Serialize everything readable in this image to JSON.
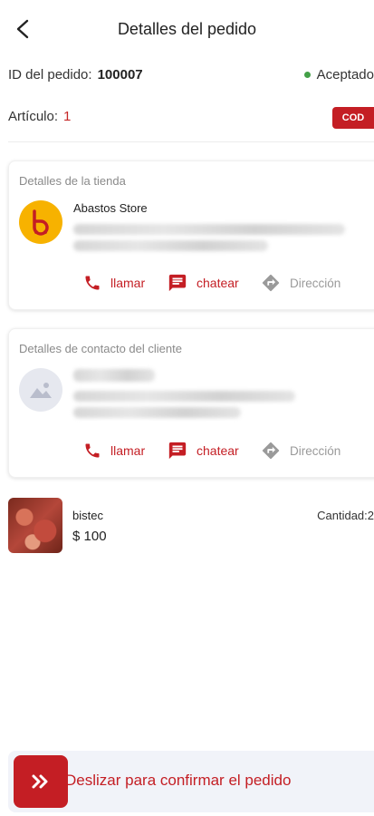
{
  "header": {
    "title": "Detalles del pedido"
  },
  "order": {
    "id_label": "ID del pedido:",
    "id_value": "100007",
    "status": "Aceptado",
    "items_label": "Artículo:",
    "items_value": "1",
    "payment_badge": "COD"
  },
  "store_card": {
    "title": "Detalles de la tienda",
    "store_name": "Abastos Store",
    "actions": {
      "call": "llamar",
      "chat": "chatear",
      "direction": "Dirección"
    }
  },
  "customer_card": {
    "title": "Detalles de contacto del cliente",
    "actions": {
      "call": "llamar",
      "chat": "chatear",
      "direction": "Dirección"
    }
  },
  "product": {
    "name": "bistec",
    "price": "$ 100",
    "quantity_label": "Cantidad:2"
  },
  "slider": {
    "label": "Deslizar para confirmar el pedido"
  },
  "colors": {
    "accent": "#c41e24",
    "status_green": "#43a047",
    "logo_yellow": "#f7b200"
  },
  "icons": [
    "back-arrow-icon",
    "phone-icon",
    "chat-icon",
    "direction-icon",
    "image-placeholder-icon",
    "double-chevron-right-icon"
  ]
}
